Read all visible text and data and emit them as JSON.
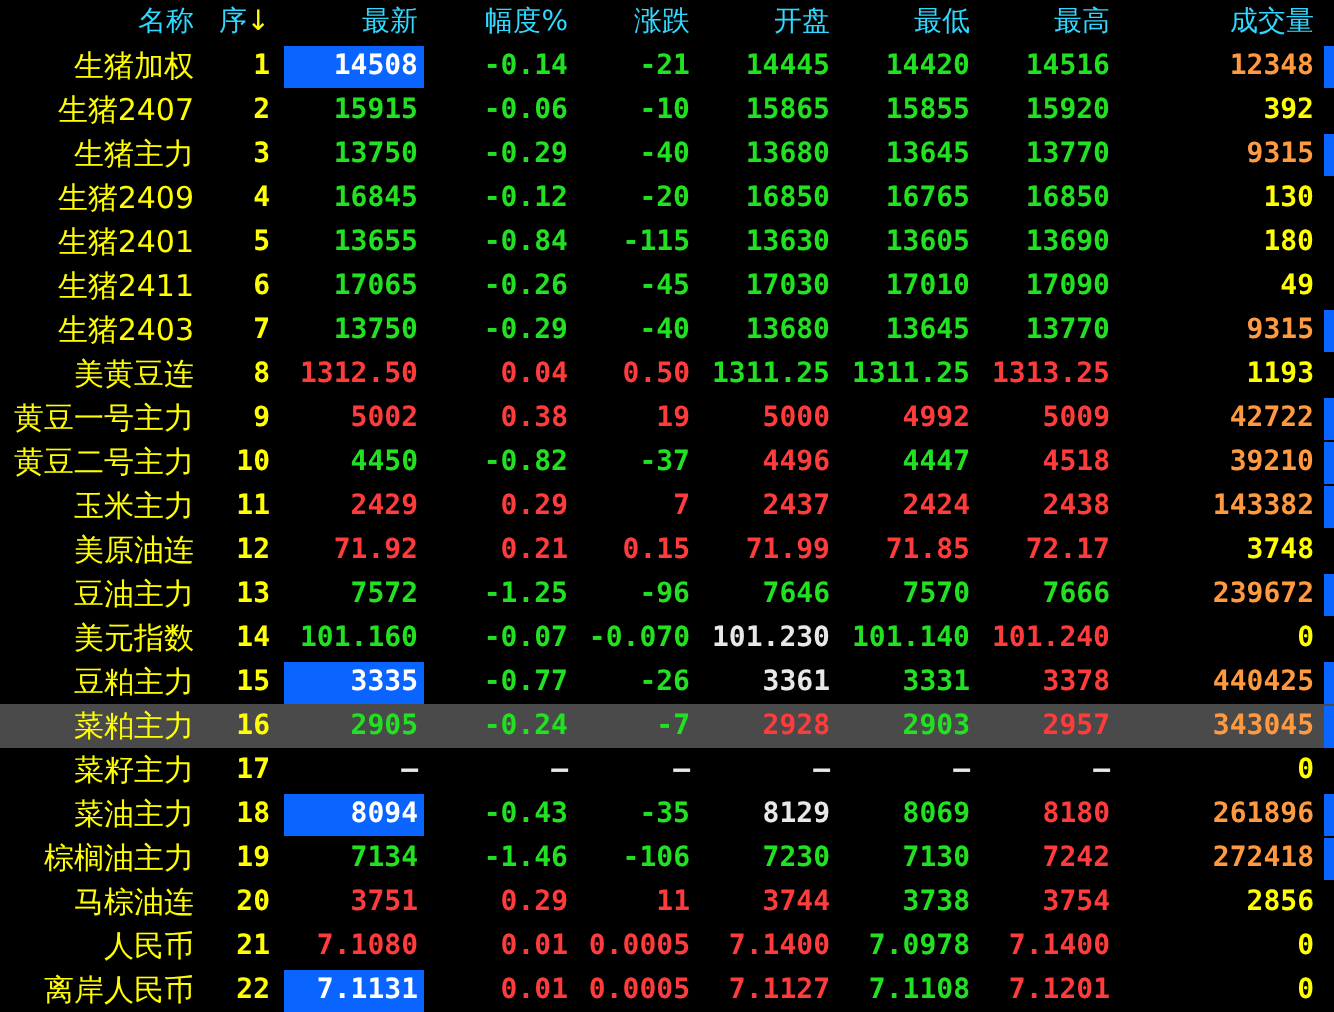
{
  "columns": [
    {
      "label": "名称"
    },
    {
      "label": "序",
      "sort_indicator": "↓"
    },
    {
      "label": "最新"
    },
    {
      "label": "幅度%"
    },
    {
      "label": "涨跌"
    },
    {
      "label": "开盘"
    },
    {
      "label": "最低"
    },
    {
      "label": "最高"
    },
    {
      "label": "成交量"
    }
  ],
  "rows": [
    {
      "name": "生猪加权",
      "no": "1",
      "selected": false,
      "latest_highlighted": true,
      "volume_marked": true,
      "cells": [
        {
          "text": "14508",
          "color": "#ffffff"
        },
        {
          "text": "-0.14",
          "color": "#22e022"
        },
        {
          "text": "-21",
          "color": "#22e022"
        },
        {
          "text": "14445",
          "color": "#22e022"
        },
        {
          "text": "14420",
          "color": "#22e022"
        },
        {
          "text": "14516",
          "color": "#22e022"
        },
        {
          "text": "12348",
          "color": "#ff9a40"
        }
      ]
    },
    {
      "name": "生猪2407",
      "no": "2",
      "selected": false,
      "latest_highlighted": false,
      "volume_marked": false,
      "cells": [
        {
          "text": "15915",
          "color": "#22e022"
        },
        {
          "text": "-0.06",
          "color": "#22e022"
        },
        {
          "text": "-10",
          "color": "#22e022"
        },
        {
          "text": "15865",
          "color": "#22e022"
        },
        {
          "text": "15855",
          "color": "#22e022"
        },
        {
          "text": "15920",
          "color": "#22e022"
        },
        {
          "text": "392",
          "color": "#ffff00"
        }
      ]
    },
    {
      "name": "生猪主力",
      "no": "3",
      "selected": false,
      "latest_highlighted": false,
      "volume_marked": true,
      "cells": [
        {
          "text": "13750",
          "color": "#22e022"
        },
        {
          "text": "-0.29",
          "color": "#22e022"
        },
        {
          "text": "-40",
          "color": "#22e022"
        },
        {
          "text": "13680",
          "color": "#22e022"
        },
        {
          "text": "13645",
          "color": "#22e022"
        },
        {
          "text": "13770",
          "color": "#22e022"
        },
        {
          "text": "9315",
          "color": "#ff9a40"
        }
      ]
    },
    {
      "name": "生猪2409",
      "no": "4",
      "selected": false,
      "latest_highlighted": false,
      "volume_marked": false,
      "cells": [
        {
          "text": "16845",
          "color": "#22e022"
        },
        {
          "text": "-0.12",
          "color": "#22e022"
        },
        {
          "text": "-20",
          "color": "#22e022"
        },
        {
          "text": "16850",
          "color": "#22e022"
        },
        {
          "text": "16765",
          "color": "#22e022"
        },
        {
          "text": "16850",
          "color": "#22e022"
        },
        {
          "text": "130",
          "color": "#ffff00"
        }
      ]
    },
    {
      "name": "生猪2401",
      "no": "5",
      "selected": false,
      "latest_highlighted": false,
      "volume_marked": false,
      "cells": [
        {
          "text": "13655",
          "color": "#22e022"
        },
        {
          "text": "-0.84",
          "color": "#22e022"
        },
        {
          "text": "-115",
          "color": "#22e022"
        },
        {
          "text": "13630",
          "color": "#22e022"
        },
        {
          "text": "13605",
          "color": "#22e022"
        },
        {
          "text": "13690",
          "color": "#22e022"
        },
        {
          "text": "180",
          "color": "#ffff00"
        }
      ]
    },
    {
      "name": "生猪2411",
      "no": "6",
      "selected": false,
      "latest_highlighted": false,
      "volume_marked": false,
      "cells": [
        {
          "text": "17065",
          "color": "#22e022"
        },
        {
          "text": "-0.26",
          "color": "#22e022"
        },
        {
          "text": "-45",
          "color": "#22e022"
        },
        {
          "text": "17030",
          "color": "#22e022"
        },
        {
          "text": "17010",
          "color": "#22e022"
        },
        {
          "text": "17090",
          "color": "#22e022"
        },
        {
          "text": "49",
          "color": "#ffff00"
        }
      ]
    },
    {
      "name": "生猪2403",
      "no": "7",
      "selected": false,
      "latest_highlighted": false,
      "volume_marked": true,
      "cells": [
        {
          "text": "13750",
          "color": "#22e022"
        },
        {
          "text": "-0.29",
          "color": "#22e022"
        },
        {
          "text": "-40",
          "color": "#22e022"
        },
        {
          "text": "13680",
          "color": "#22e022"
        },
        {
          "text": "13645",
          "color": "#22e022"
        },
        {
          "text": "13770",
          "color": "#22e022"
        },
        {
          "text": "9315",
          "color": "#ff9a40"
        }
      ]
    },
    {
      "name": "美黄豆连",
      "no": "8",
      "selected": false,
      "latest_highlighted": false,
      "volume_marked": false,
      "cells": [
        {
          "text": "1312.50",
          "color": "#ff3c3c"
        },
        {
          "text": "0.04",
          "color": "#ff3c3c"
        },
        {
          "text": "0.50",
          "color": "#ff3c3c"
        },
        {
          "text": "1311.25",
          "color": "#22e022"
        },
        {
          "text": "1311.25",
          "color": "#22e022"
        },
        {
          "text": "1313.25",
          "color": "#ff3c3c"
        },
        {
          "text": "1193",
          "color": "#ffff00"
        }
      ]
    },
    {
      "name": "黄豆一号主力",
      "no": "9",
      "selected": false,
      "latest_highlighted": false,
      "volume_marked": true,
      "cells": [
        {
          "text": "5002",
          "color": "#ff3c3c"
        },
        {
          "text": "0.38",
          "color": "#ff3c3c"
        },
        {
          "text": "19",
          "color": "#ff3c3c"
        },
        {
          "text": "5000",
          "color": "#ff3c3c"
        },
        {
          "text": "4992",
          "color": "#ff3c3c"
        },
        {
          "text": "5009",
          "color": "#ff3c3c"
        },
        {
          "text": "42722",
          "color": "#ff9a40"
        }
      ]
    },
    {
      "name": "黄豆二号主力",
      "no": "10",
      "selected": false,
      "latest_highlighted": false,
      "volume_marked": true,
      "cells": [
        {
          "text": "4450",
          "color": "#22e022"
        },
        {
          "text": "-0.82",
          "color": "#22e022"
        },
        {
          "text": "-37",
          "color": "#22e022"
        },
        {
          "text": "4496",
          "color": "#ff3c3c"
        },
        {
          "text": "4447",
          "color": "#22e022"
        },
        {
          "text": "4518",
          "color": "#ff3c3c"
        },
        {
          "text": "39210",
          "color": "#ff9a40"
        }
      ]
    },
    {
      "name": "玉米主力",
      "no": "11",
      "selected": false,
      "latest_highlighted": false,
      "volume_marked": true,
      "cells": [
        {
          "text": "2429",
          "color": "#ff3c3c"
        },
        {
          "text": "0.29",
          "color": "#ff3c3c"
        },
        {
          "text": "7",
          "color": "#ff3c3c"
        },
        {
          "text": "2437",
          "color": "#ff3c3c"
        },
        {
          "text": "2424",
          "color": "#ff3c3c"
        },
        {
          "text": "2438",
          "color": "#ff3c3c"
        },
        {
          "text": "143382",
          "color": "#ff9a40"
        }
      ]
    },
    {
      "name": "美原油连",
      "no": "12",
      "selected": false,
      "latest_highlighted": false,
      "volume_marked": false,
      "cells": [
        {
          "text": "71.92",
          "color": "#ff3c3c"
        },
        {
          "text": "0.21",
          "color": "#ff3c3c"
        },
        {
          "text": "0.15",
          "color": "#ff3c3c"
        },
        {
          "text": "71.99",
          "color": "#ff3c3c"
        },
        {
          "text": "71.85",
          "color": "#ff3c3c"
        },
        {
          "text": "72.17",
          "color": "#ff3c3c"
        },
        {
          "text": "3748",
          "color": "#ffff00"
        }
      ]
    },
    {
      "name": "豆油主力",
      "no": "13",
      "selected": false,
      "latest_highlighted": false,
      "volume_marked": true,
      "cells": [
        {
          "text": "7572",
          "color": "#22e022"
        },
        {
          "text": "-1.25",
          "color": "#22e022"
        },
        {
          "text": "-96",
          "color": "#22e022"
        },
        {
          "text": "7646",
          "color": "#22e022"
        },
        {
          "text": "7570",
          "color": "#22e022"
        },
        {
          "text": "7666",
          "color": "#22e022"
        },
        {
          "text": "239672",
          "color": "#ff9a40"
        }
      ]
    },
    {
      "name": "美元指数",
      "no": "14",
      "selected": false,
      "latest_highlighted": false,
      "volume_marked": false,
      "cells": [
        {
          "text": "101.160",
          "color": "#22e022"
        },
        {
          "text": "-0.07",
          "color": "#22e022"
        },
        {
          "text": "-0.070",
          "color": "#22e022"
        },
        {
          "text": "101.230",
          "color": "#e8e8e8"
        },
        {
          "text": "101.140",
          "color": "#22e022"
        },
        {
          "text": "101.240",
          "color": "#ff3c3c"
        },
        {
          "text": "0",
          "color": "#ffff00"
        }
      ]
    },
    {
      "name": "豆粕主力",
      "no": "15",
      "selected": false,
      "latest_highlighted": true,
      "volume_marked": true,
      "cells": [
        {
          "text": "3335",
          "color": "#ffffff"
        },
        {
          "text": "-0.77",
          "color": "#22e022"
        },
        {
          "text": "-26",
          "color": "#22e022"
        },
        {
          "text": "3361",
          "color": "#e8e8e8"
        },
        {
          "text": "3331",
          "color": "#22e022"
        },
        {
          "text": "3378",
          "color": "#ff3c3c"
        },
        {
          "text": "440425",
          "color": "#ff9a40"
        }
      ]
    },
    {
      "name": "菜粕主力",
      "no": "16",
      "selected": true,
      "latest_highlighted": false,
      "volume_marked": true,
      "cells": [
        {
          "text": "2905",
          "color": "#22e022"
        },
        {
          "text": "-0.24",
          "color": "#22e022"
        },
        {
          "text": "-7",
          "color": "#22e022"
        },
        {
          "text": "2928",
          "color": "#ff3c3c"
        },
        {
          "text": "2903",
          "color": "#22e022"
        },
        {
          "text": "2957",
          "color": "#ff3c3c"
        },
        {
          "text": "343045",
          "color": "#ff9a40"
        }
      ]
    },
    {
      "name": "菜籽主力",
      "no": "17",
      "selected": false,
      "latest_highlighted": false,
      "volume_marked": false,
      "cells": [
        {
          "text": "—",
          "color": "#e8e8e8"
        },
        {
          "text": "—",
          "color": "#e8e8e8"
        },
        {
          "text": "—",
          "color": "#e8e8e8"
        },
        {
          "text": "—",
          "color": "#e8e8e8"
        },
        {
          "text": "—",
          "color": "#e8e8e8"
        },
        {
          "text": "—",
          "color": "#e8e8e8"
        },
        {
          "text": "0",
          "color": "#ffff00"
        }
      ]
    },
    {
      "name": "菜油主力",
      "no": "18",
      "selected": false,
      "latest_highlighted": true,
      "volume_marked": true,
      "cells": [
        {
          "text": "8094",
          "color": "#ffffff"
        },
        {
          "text": "-0.43",
          "color": "#22e022"
        },
        {
          "text": "-35",
          "color": "#22e022"
        },
        {
          "text": "8129",
          "color": "#e8e8e8"
        },
        {
          "text": "8069",
          "color": "#22e022"
        },
        {
          "text": "8180",
          "color": "#ff3c3c"
        },
        {
          "text": "261896",
          "color": "#ff9a40"
        }
      ]
    },
    {
      "name": "棕榈油主力",
      "no": "19",
      "selected": false,
      "latest_highlighted": false,
      "volume_marked": true,
      "cells": [
        {
          "text": "7134",
          "color": "#22e022"
        },
        {
          "text": "-1.46",
          "color": "#22e022"
        },
        {
          "text": "-106",
          "color": "#22e022"
        },
        {
          "text": "7230",
          "color": "#22e022"
        },
        {
          "text": "7130",
          "color": "#22e022"
        },
        {
          "text": "7242",
          "color": "#ff3c3c"
        },
        {
          "text": "272418",
          "color": "#ff9a40"
        }
      ]
    },
    {
      "name": "马棕油连",
      "no": "20",
      "selected": false,
      "latest_highlighted": false,
      "volume_marked": false,
      "cells": [
        {
          "text": "3751",
          "color": "#ff3c3c"
        },
        {
          "text": "0.29",
          "color": "#ff3c3c"
        },
        {
          "text": "11",
          "color": "#ff3c3c"
        },
        {
          "text": "3744",
          "color": "#ff3c3c"
        },
        {
          "text": "3738",
          "color": "#22e022"
        },
        {
          "text": "3754",
          "color": "#ff3c3c"
        },
        {
          "text": "2856",
          "color": "#ffff00"
        }
      ]
    },
    {
      "name": "人民币",
      "no": "21",
      "selected": false,
      "latest_highlighted": false,
      "volume_marked": false,
      "cells": [
        {
          "text": "7.1080",
          "color": "#ff3c3c"
        },
        {
          "text": "0.01",
          "color": "#ff3c3c"
        },
        {
          "text": "0.0005",
          "color": "#ff3c3c"
        },
        {
          "text": "7.1400",
          "color": "#ff3c3c"
        },
        {
          "text": "7.0978",
          "color": "#22e022"
        },
        {
          "text": "7.1400",
          "color": "#ff3c3c"
        },
        {
          "text": "0",
          "color": "#ffff00"
        }
      ]
    },
    {
      "name": "离岸人民币",
      "no": "22",
      "selected": false,
      "latest_highlighted": true,
      "volume_marked": false,
      "cells": [
        {
          "text": "7.1131",
          "color": "#ffffff"
        },
        {
          "text": "0.01",
          "color": "#ff3c3c"
        },
        {
          "text": "0.0005",
          "color": "#ff3c3c"
        },
        {
          "text": "7.1127",
          "color": "#ff3c3c"
        },
        {
          "text": "7.1108",
          "color": "#22e022"
        },
        {
          "text": "7.1201",
          "color": "#ff3c3c"
        },
        {
          "text": "0",
          "color": "#ffff00"
        }
      ]
    }
  ]
}
